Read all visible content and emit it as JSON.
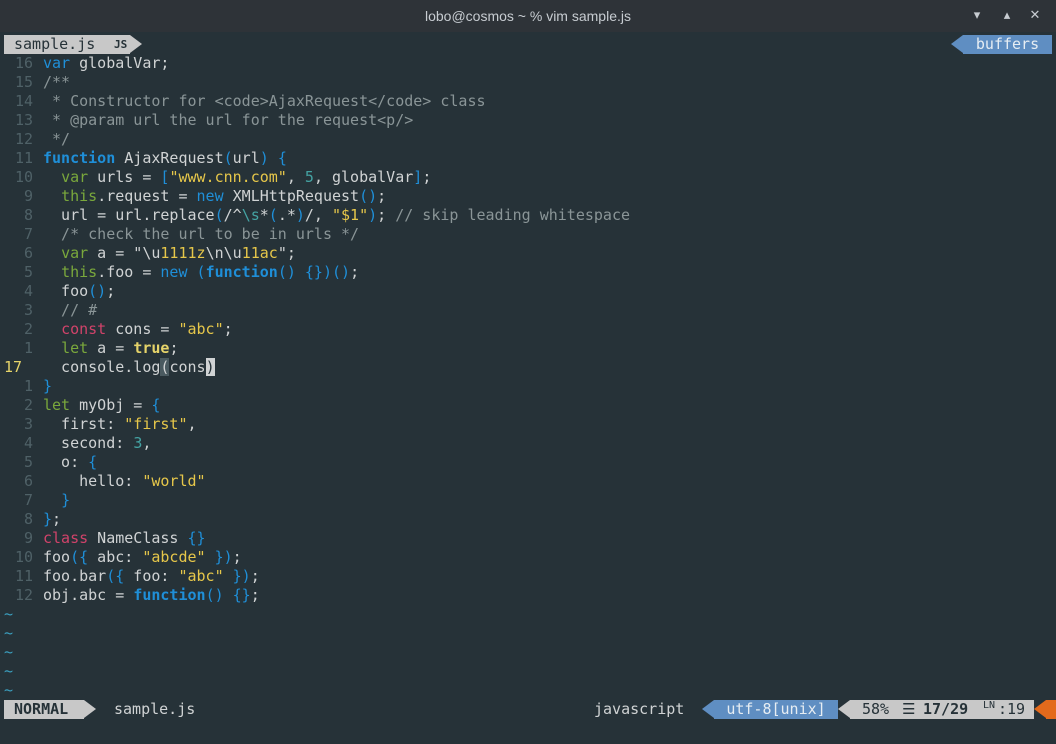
{
  "window": {
    "title": "lobo@cosmos ~ % vim sample.js"
  },
  "tabline": {
    "file": "sample.js",
    "badge": "JS",
    "buffers_label": "buffers"
  },
  "lines": [
    {
      "ln": "16",
      "code": "var globalVar;"
    },
    {
      "ln": "15",
      "code": "/**"
    },
    {
      "ln": "14",
      "code": " * Constructor for <code>AjaxRequest</code> class"
    },
    {
      "ln": "13",
      "code": " * @param url the url for the request<p/>"
    },
    {
      "ln": "12",
      "code": " */"
    },
    {
      "ln": "11",
      "code": "function AjaxRequest(url) {"
    },
    {
      "ln": "10",
      "code": "  var urls = [\"www.cnn.com\", 5, globalVar];"
    },
    {
      "ln": "9",
      "code": "  this.request = new XMLHttpRequest();"
    },
    {
      "ln": "8",
      "code": "  url = url.replace(/^\\s*(.*)/, \"$1\"); // skip leading whitespace"
    },
    {
      "ln": "7",
      "code": "  /* check the url to be in urls */"
    },
    {
      "ln": "6",
      "code": "  var a = \"\\u1111z\\n\\u11ac\";"
    },
    {
      "ln": "5",
      "code": "  this.foo = new (function() {})();"
    },
    {
      "ln": "4",
      "code": "  foo();"
    },
    {
      "ln": "3",
      "code": "  // #"
    },
    {
      "ln": "2",
      "code": "  const cons = \"abc\";"
    },
    {
      "ln": "1",
      "code": "  let a = true;"
    },
    {
      "ln": "17",
      "code": "  console.log(cons)",
      "current": true
    },
    {
      "ln": "1",
      "code": "}"
    },
    {
      "ln": "2",
      "code": "let myObj = {"
    },
    {
      "ln": "3",
      "code": "  first: \"first\","
    },
    {
      "ln": "4",
      "code": "  second: 3,"
    },
    {
      "ln": "5",
      "code": "  o: {"
    },
    {
      "ln": "6",
      "code": "    hello: \"world\""
    },
    {
      "ln": "7",
      "code": "  }"
    },
    {
      "ln": "8",
      "code": "};"
    },
    {
      "ln": "9",
      "code": "class NameClass {}"
    },
    {
      "ln": "10",
      "code": "foo({ abc: \"abcde\" });"
    },
    {
      "ln": "11",
      "code": "foo.bar({ foo: \"abc\" });"
    },
    {
      "ln": "12",
      "code": "obj.abc = function() {};"
    }
  ],
  "empty_marker": "~",
  "statusline": {
    "mode": "NORMAL",
    "file": "sample.js",
    "filetype": "javascript",
    "encoding": "utf-8[unix]",
    "percent": "58%",
    "line_icon": "☰",
    "line_pos": "17/29",
    "col_icon": "LN",
    "col": ":19"
  },
  "colors": {
    "background": "#263238",
    "keyword": "#1f8fd8",
    "storage": "#d1436a",
    "string": "#e6c74a",
    "number": "#44a3a3",
    "comment": "#8a9597",
    "accent_blue": "#5f8ec2",
    "warning": "#e36a1c"
  }
}
